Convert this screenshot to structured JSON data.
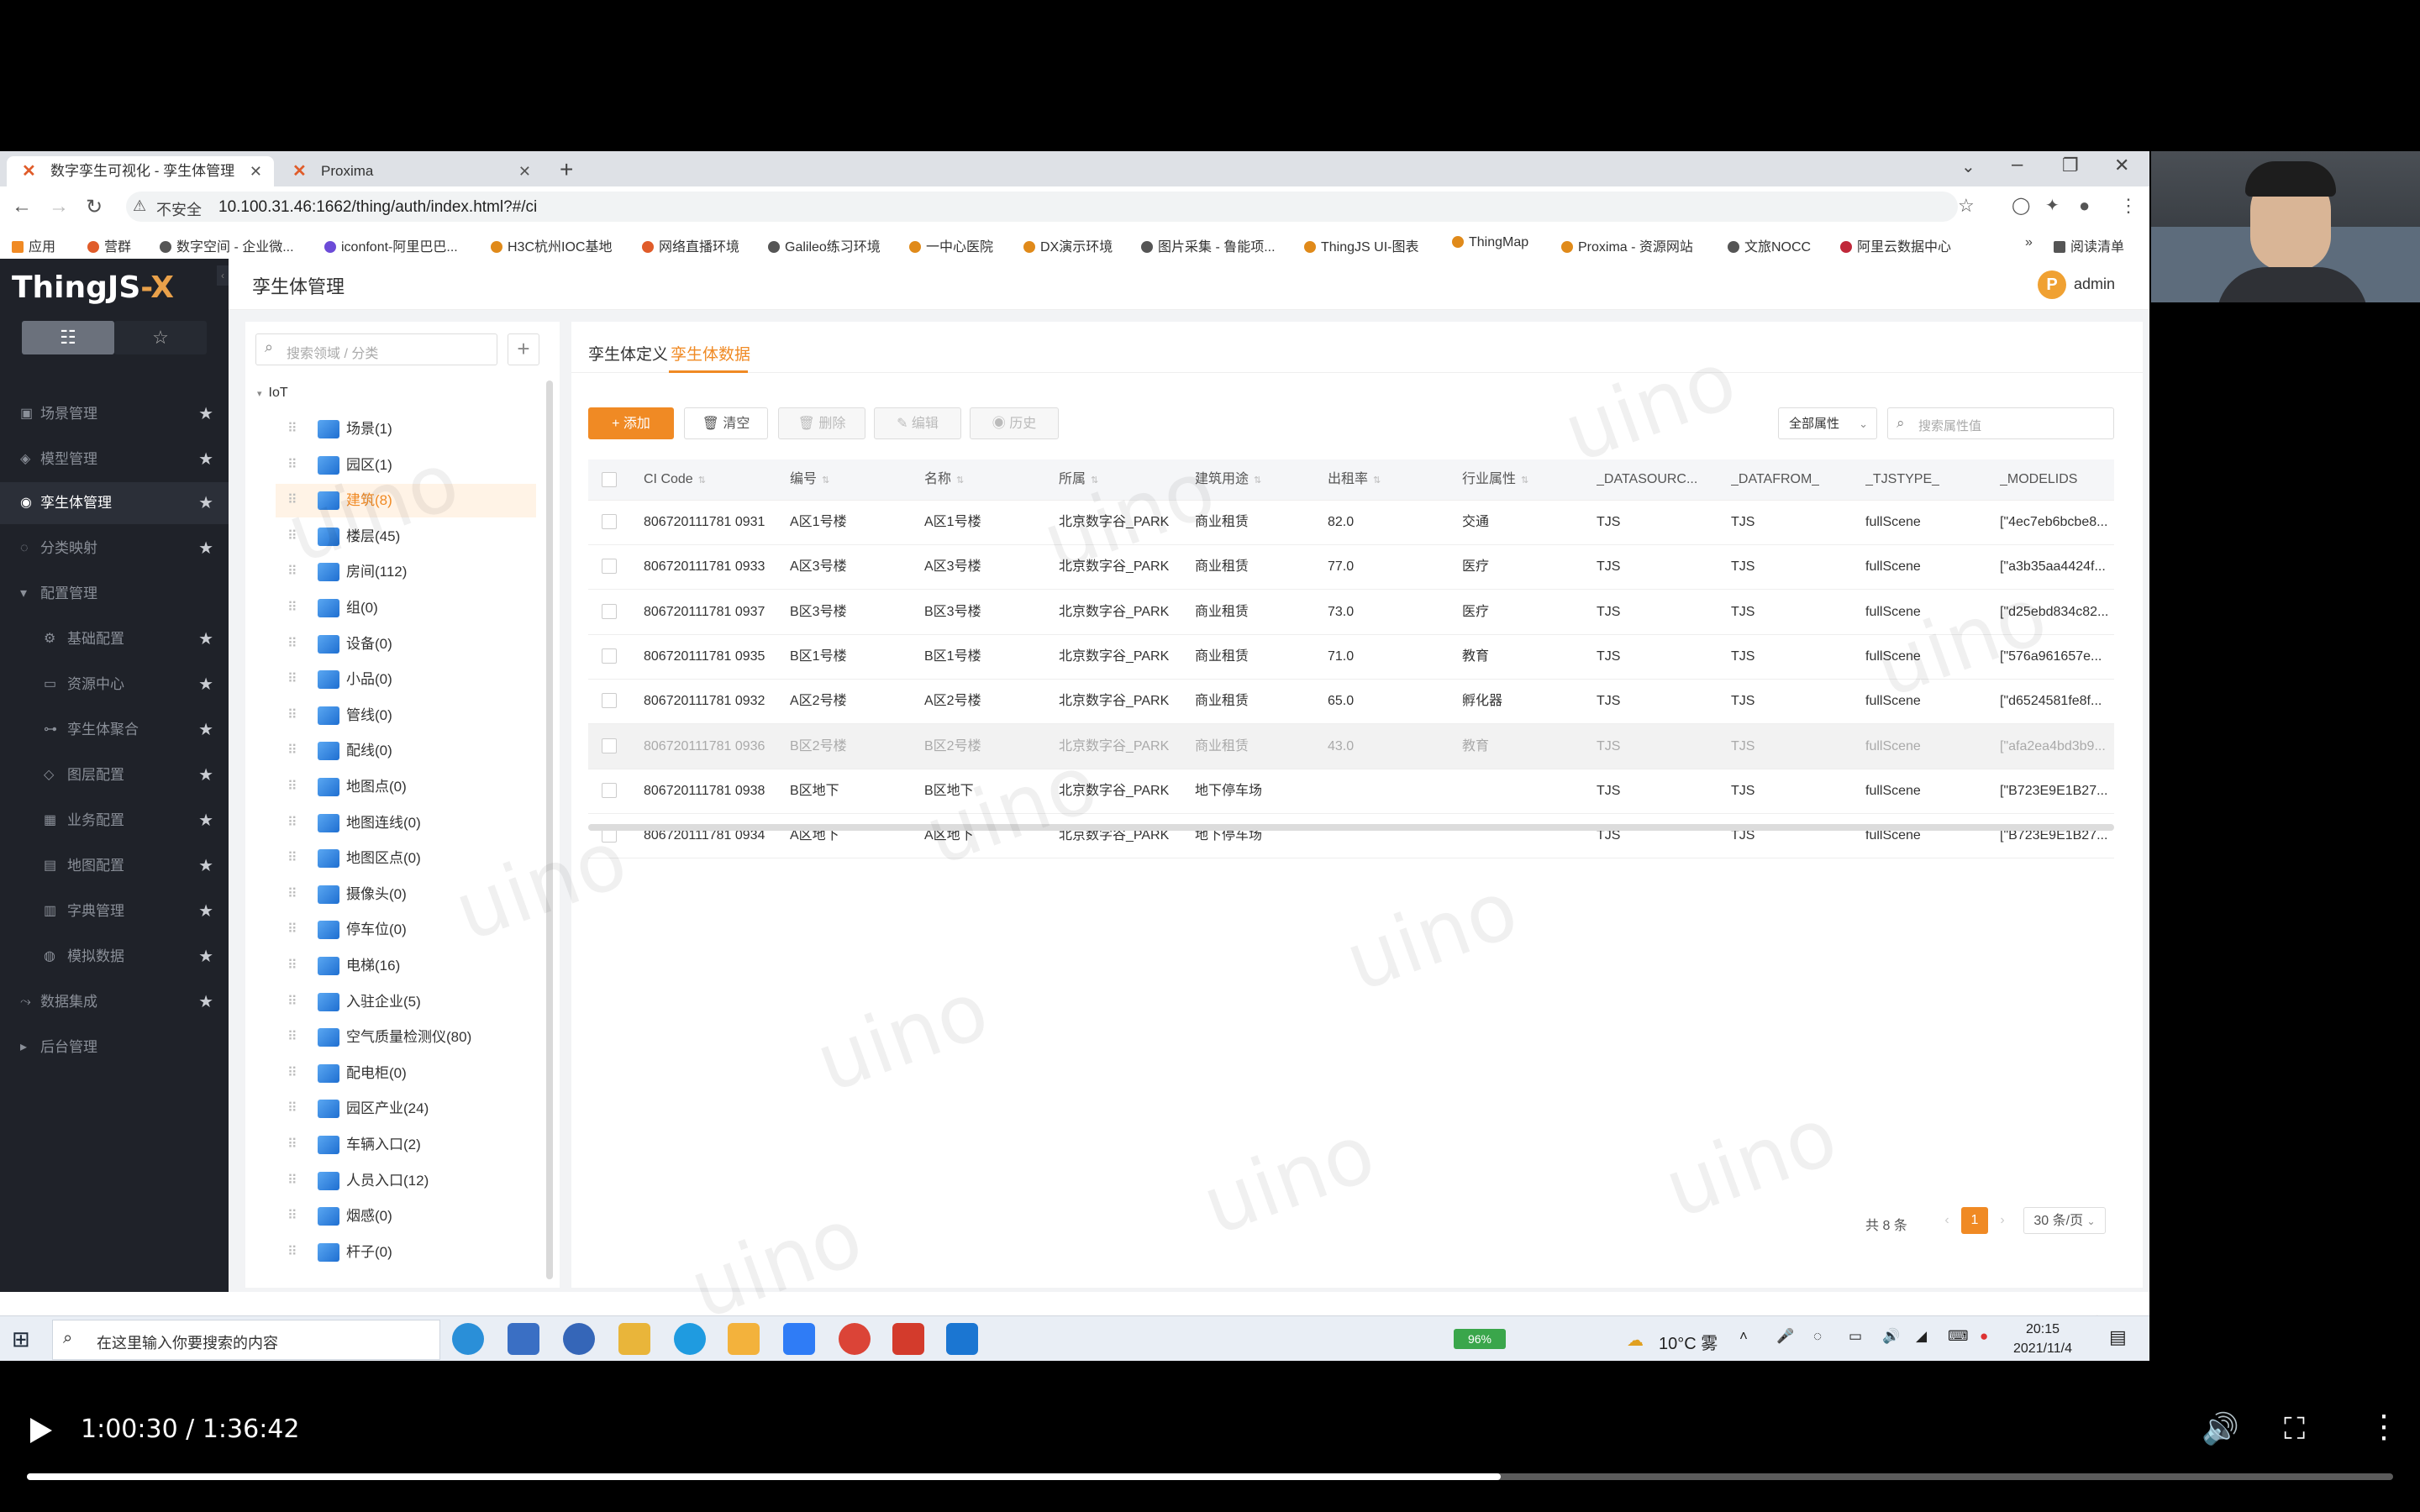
{
  "browser": {
    "tabs": [
      {
        "label": "数字孪生可视化 - 孪生体管理",
        "active": true
      },
      {
        "label": "Proxima",
        "active": false
      }
    ],
    "security_label": "不安全",
    "url": "10.100.31.46:1662/thing/auth/index.html?#/ci",
    "bookmarks": [
      "应用",
      "营群",
      "数字空间 - 企业微...",
      "iconfont-阿里巴巴...",
      "H3C杭州IOC基地",
      "网络直播环境",
      "Galileo练习环境",
      "一中心医院",
      "DX演示环境",
      "图片采集 - 鲁能项...",
      "ThingJS UI-图表",
      "ThingMap",
      "Proxima - 资源网站",
      "文旅NOCC",
      "阿里云数据中心",
      "阅读清单"
    ]
  },
  "app": {
    "logo": {
      "brand": "ThingJS",
      "suffix": "-X"
    },
    "title": "孪生体管理",
    "user": {
      "avatar_letter": "P",
      "name": "admin"
    },
    "accent_color": "#f08a24",
    "sidebar": {
      "view_toggles": [
        {
          "icon": "list-icon",
          "glyph": "☷"
        },
        {
          "icon": "star-icon",
          "glyph": "☆"
        }
      ],
      "items": [
        {
          "label": "场景管理",
          "icon": "scene-icon",
          "glyph": "▣",
          "active": false,
          "sub": false,
          "star": true
        },
        {
          "label": "模型管理",
          "icon": "model-icon",
          "glyph": "◈",
          "active": false,
          "sub": false,
          "star": true
        },
        {
          "label": "孪生体管理",
          "icon": "twin-icon",
          "glyph": "◉",
          "active": true,
          "sub": false,
          "star": true
        },
        {
          "label": "分类映射",
          "icon": "mapping-icon",
          "glyph": "◌",
          "active": false,
          "sub": false,
          "star": true
        },
        {
          "label": "配置管理",
          "icon": "caret-down-icon",
          "glyph": "▾",
          "active": false,
          "sub": false,
          "star": false
        },
        {
          "label": "基础配置",
          "icon": "config-icon",
          "glyph": "⚙",
          "active": false,
          "sub": true,
          "star": true
        },
        {
          "label": "资源中心",
          "icon": "folder-icon",
          "glyph": "▭",
          "active": false,
          "sub": true,
          "star": true
        },
        {
          "label": "孪生体聚合",
          "icon": "aggregate-icon",
          "glyph": "⊶",
          "active": false,
          "sub": true,
          "star": true
        },
        {
          "label": "图层配置",
          "icon": "layers-icon",
          "glyph": "◇",
          "active": false,
          "sub": true,
          "star": true
        },
        {
          "label": "业务配置",
          "icon": "business-icon",
          "glyph": "▦",
          "active": false,
          "sub": true,
          "star": true
        },
        {
          "label": "地图配置",
          "icon": "map-icon",
          "glyph": "▤",
          "active": false,
          "sub": true,
          "star": true
        },
        {
          "label": "字典管理",
          "icon": "dictionary-icon",
          "glyph": "▥",
          "active": false,
          "sub": true,
          "star": true
        },
        {
          "label": "模拟数据",
          "icon": "mock-data-icon",
          "glyph": "◍",
          "active": false,
          "sub": true,
          "star": true
        },
        {
          "label": "数据集成",
          "icon": "integration-icon",
          "glyph": "⤳",
          "active": false,
          "sub": false,
          "star": true
        },
        {
          "label": "后台管理",
          "icon": "caret-right-icon",
          "glyph": "▸",
          "active": false,
          "sub": false,
          "star": false
        }
      ]
    },
    "tree": {
      "search_placeholder": "搜索领域 / 分类",
      "root": "IoT",
      "nodes": [
        "场景(1)",
        "园区(1)",
        "建筑(8)",
        "楼层(45)",
        "房间(112)",
        "组(0)",
        "设备(0)",
        "小品(0)",
        "管线(0)",
        "配线(0)",
        "地图点(0)",
        "地图连线(0)",
        "地图区点(0)",
        "摄像头(0)",
        "停车位(0)",
        "电梯(16)",
        "入驻企业(5)",
        "空气质量检测仪(80)",
        "配电柜(0)",
        "园区产业(24)",
        "车辆入口(2)",
        "人员入口(12)",
        "烟感(0)",
        "杆子(0)"
      ],
      "selected_index": 2
    },
    "panel_tabs": [
      "孪生体定义",
      "孪生体数据"
    ],
    "active_panel_tab": 1,
    "toolbar": {
      "add": "添加",
      "clear": "清空",
      "delete": "删除",
      "edit": "编辑",
      "history": "历史",
      "attr_select": "全部属性",
      "search_placeholder": "搜索属性值"
    },
    "table": {
      "columns": [
        "CI Code",
        "编号",
        "名称",
        "所属",
        "建筑用途",
        "出租率",
        "行业属性",
        "_DATASOURC...",
        "_DATAFROM_",
        "_TJSTYPE_",
        "_MODELIDS"
      ],
      "rows": [
        [
          "806720111781 0931",
          "A区1号楼",
          "A区1号楼",
          "北京数字谷_PARK",
          "商业租赁",
          "82.0",
          "交通",
          "TJS",
          "TJS",
          "fullScene",
          "[\"4ec7eb6bcbe8..."
        ],
        [
          "806720111781 0933",
          "A区3号楼",
          "A区3号楼",
          "北京数字谷_PARK",
          "商业租赁",
          "77.0",
          "医疗",
          "TJS",
          "TJS",
          "fullScene",
          "[\"a3b35aa4424f..."
        ],
        [
          "806720111781 0937",
          "B区3号楼",
          "B区3号楼",
          "北京数字谷_PARK",
          "商业租赁",
          "73.0",
          "医疗",
          "TJS",
          "TJS",
          "fullScene",
          "[\"d25ebd834c82..."
        ],
        [
          "806720111781 0935",
          "B区1号楼",
          "B区1号楼",
          "北京数字谷_PARK",
          "商业租赁",
          "71.0",
          "教育",
          "TJS",
          "TJS",
          "fullScene",
          "[\"576a961657e..."
        ],
        [
          "806720111781 0932",
          "A区2号楼",
          "A区2号楼",
          "北京数字谷_PARK",
          "商业租赁",
          "65.0",
          "孵化器",
          "TJS",
          "TJS",
          "fullScene",
          "[\"d6524581fe8f..."
        ],
        [
          "806720111781 0936",
          "B区2号楼",
          "B区2号楼",
          "北京数字谷_PARK",
          "商业租赁",
          "43.0",
          "教育",
          "TJS",
          "TJS",
          "fullScene",
          "[\"afa2ea4bd3b9..."
        ],
        [
          "806720111781 0938",
          "B区地下",
          "B区地下",
          "北京数字谷_PARK",
          "地下停车场",
          "",
          "",
          "TJS",
          "TJS",
          "fullScene",
          "[\"B723E9E1B27..."
        ],
        [
          "806720111781 0934",
          "A区地下",
          "A区地下",
          "北京数字谷_PARK",
          "地下停车场",
          "",
          "",
          "TJS",
          "TJS",
          "fullScene",
          "[\"B723E9E1B27..."
        ]
      ],
      "hover_row": 5
    },
    "pagination": {
      "total": "共 8 条",
      "current_page": "1",
      "page_size": "30 条/页"
    },
    "watermark": "uino"
  },
  "taskbar": {
    "search_placeholder": "在这里输入你要搜索的内容",
    "battery": "96%",
    "weather": "10°C 雾",
    "time": "20:15",
    "date": "2021/11/4"
  },
  "video": {
    "time": "1:00:30 / 1:36:42",
    "progress": 0.6228
  }
}
